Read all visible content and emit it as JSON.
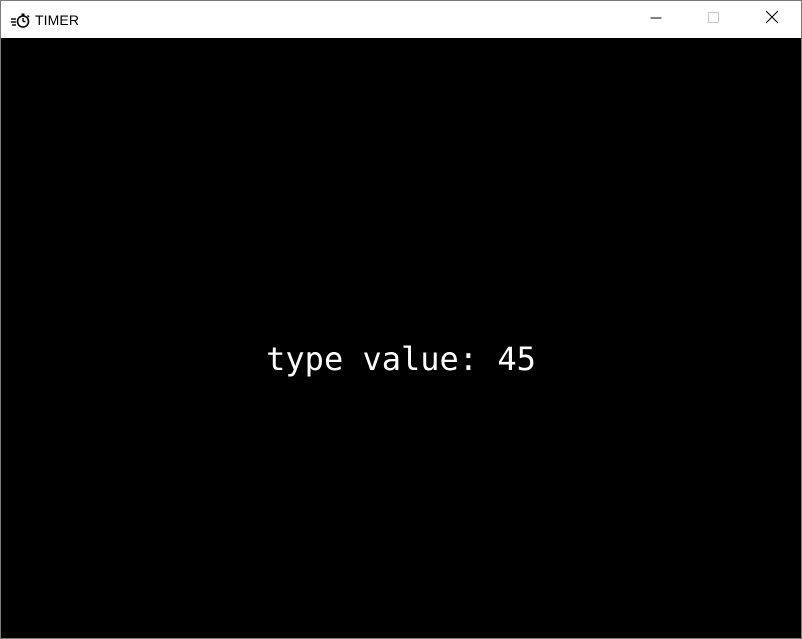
{
  "window": {
    "title": "TIMER",
    "icon": "stopwatch-icon",
    "controls": {
      "minimize": "minimize-icon",
      "maximize": "maximize-icon",
      "close": "close-icon"
    }
  },
  "content": {
    "prompt_label": "type value: ",
    "prompt_value": "45",
    "background_color": "#000000",
    "text_color": "#ffffff"
  }
}
